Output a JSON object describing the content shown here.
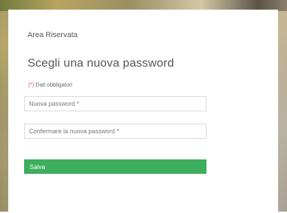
{
  "header": {
    "section_label": "Area Riservata",
    "title": "Scegli una nuova password"
  },
  "form": {
    "required_mark": "(*)",
    "required_text": " Dati obbligatori",
    "new_password_placeholder": "Nuova password *",
    "confirm_password_placeholder": "Confermare la nuova password *",
    "new_password_value": "",
    "confirm_password_value": "",
    "save_label": "Salva"
  },
  "colors": {
    "primary_button": "#3dae5c",
    "required_mark": "#d9534f",
    "text": "#555555"
  }
}
